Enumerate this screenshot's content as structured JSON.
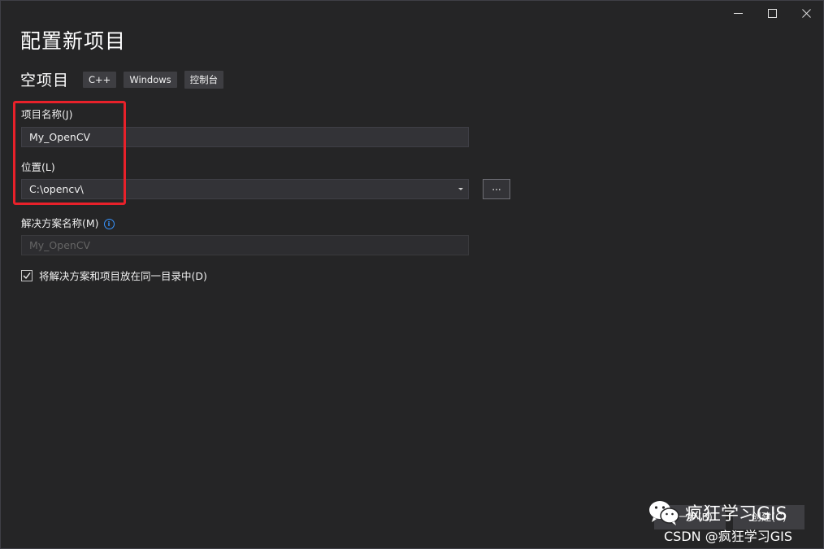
{
  "window": {
    "controls": {
      "minimize_icon": "minimize-icon",
      "maximize_icon": "maximize-icon",
      "close_icon": "close-icon"
    }
  },
  "header": {
    "title": "配置新项目",
    "template_name": "空项目",
    "tags": [
      "C++",
      "Windows",
      "控制台"
    ]
  },
  "form": {
    "project_name": {
      "label": "项目名称(J)",
      "value": "My_OpenCV"
    },
    "location": {
      "label": "位置(L)",
      "value": "C:\\opencv\\",
      "browse_label": "..."
    },
    "solution_name": {
      "label": "解决方案名称(M)",
      "value": "My_OpenCV",
      "info_icon": "info-icon"
    },
    "same_directory": {
      "label": "将解决方案和项目放在同一目录中(D)",
      "checked": true
    }
  },
  "footer": {
    "back_label": "上一步(B)",
    "create_label": "创建(C)"
  },
  "watermark": {
    "wechat_text": "疯狂学习GIS",
    "csdn_text": "CSDN @疯狂学习GIS"
  },
  "colors": {
    "background": "#252526",
    "highlight": "#e8212a",
    "accent": "#3794ff"
  }
}
